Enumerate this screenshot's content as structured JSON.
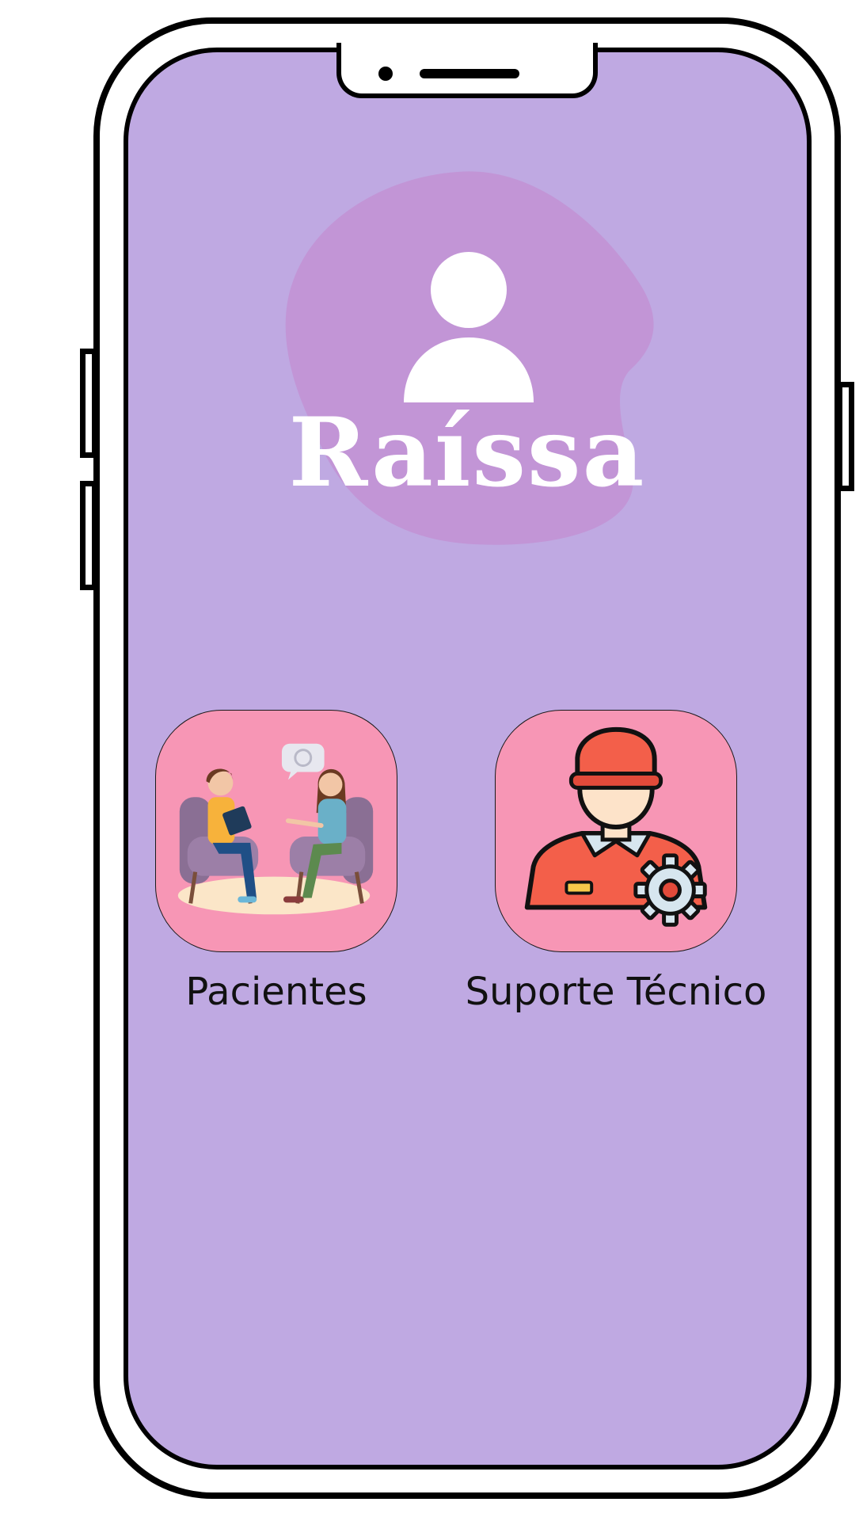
{
  "app": {
    "brand_name": "Raíssa",
    "background_color": "#bfa9e2",
    "blob_color": "#c295d6",
    "avatar_icon": "user-icon"
  },
  "menu": [
    {
      "label": "Pacientes",
      "icon": "therapy-session-icon",
      "tile_color": "#f796b5"
    },
    {
      "label": "Suporte Técnico",
      "icon": "technician-gear-icon",
      "tile_color": "#f796b5"
    }
  ]
}
